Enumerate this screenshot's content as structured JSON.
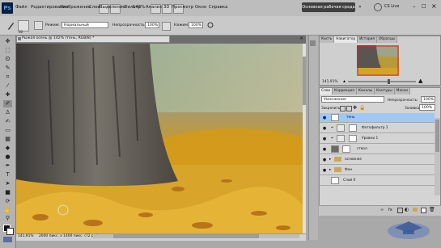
{
  "app": {
    "logo": "Ps",
    "zoom": "142%",
    "workspace_button": "Основная рабочая среда",
    "cs_live": "CS Live"
  },
  "menu": [
    "Файл",
    "Редактирование",
    "Изображение",
    "Слои",
    "Выделение",
    "Фильтр",
    "Анализ",
    "3D",
    "Просмотр",
    "Окно",
    "Справка"
  ],
  "options": {
    "brush_size": "30",
    "mode_label": "Режим:",
    "mode_value": "Нормальный",
    "opacity_label": "Непрозрачность:",
    "opacity_value": "100%",
    "pressure_label": "Нажим:",
    "pressure_value": "100%"
  },
  "document": {
    "title": "Рыжая осень @ 142% (тень, RGB/8) *",
    "zoom_status": "141,91%",
    "doc_info": "2000 пикс. x 1400 пикс. (72 ppi)"
  },
  "navigator": {
    "tabs": [
      "Кисть",
      "Навигатор",
      "История",
      "Образцы"
    ],
    "active_tab": 1,
    "zoom": "141,91%"
  },
  "layers_panel": {
    "tabs": [
      "Слои",
      "Коррекция",
      "Каналы",
      "Контуры",
      "Маски"
    ],
    "blend_mode": "Умножение",
    "opacity_label": "Непрозрачность:",
    "opacity_value": "100%",
    "lock_label": "Закрепить:",
    "fill_label": "Заливка:",
    "fill_value": "100%",
    "layers": [
      {
        "name": "тень",
        "selected": true
      },
      {
        "name": "Фотофильтр 1",
        "selected": false
      },
      {
        "name": "Уровни 1",
        "selected": false
      },
      {
        "name": "ствол",
        "selected": false
      },
      {
        "name": "основное",
        "selected": false
      },
      {
        "name": "Фон",
        "selected": false
      },
      {
        "name": "Слой 0",
        "selected": false
      }
    ]
  },
  "colors": {
    "accent": "#3d8fe0",
    "selected_layer": "#9ec8f5",
    "app_bar": "#bdbdbd"
  }
}
